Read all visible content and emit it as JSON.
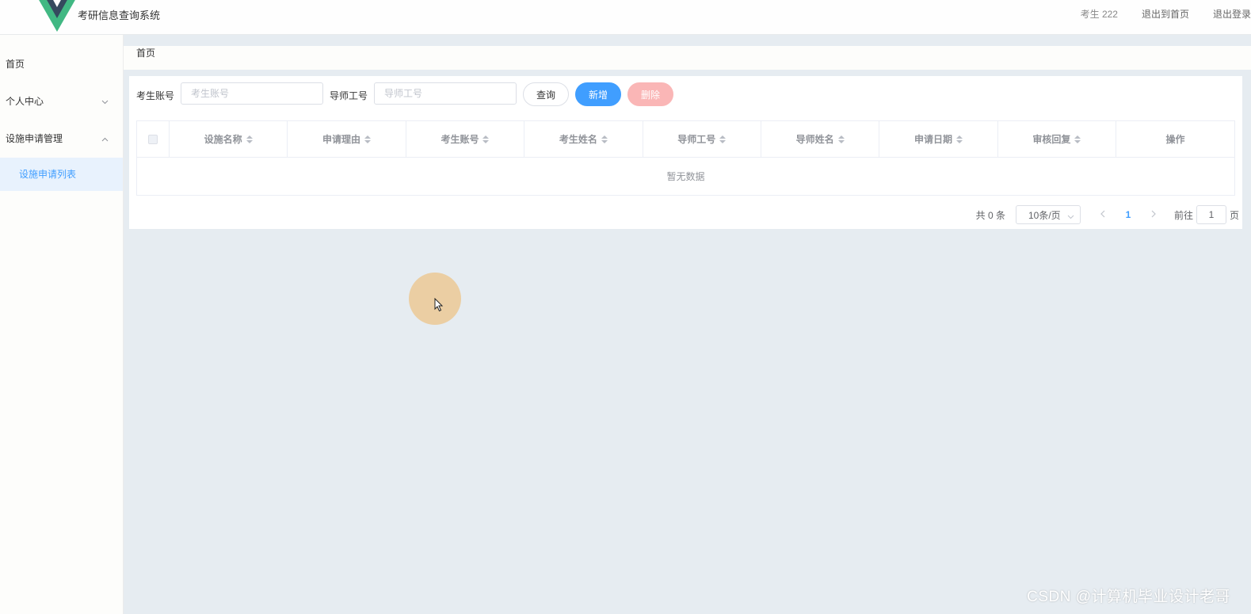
{
  "header": {
    "app_title": "考研信息查询系统",
    "user": "考生 222",
    "back_home": "退出到首页",
    "logout": "退出登录"
  },
  "sidebar": {
    "items": [
      {
        "label": "首页"
      },
      {
        "label": "个人中心"
      },
      {
        "label": "设施申请管理"
      }
    ],
    "sub_item": "设施申请列表"
  },
  "breadcrumb": "首页",
  "search": {
    "account_label": "考生账号",
    "account_placeholder": "考生账号",
    "mentor_label": "导师工号",
    "mentor_placeholder": "导师工号",
    "query": "查询",
    "add": "新增",
    "delete": "删除"
  },
  "table": {
    "columns": [
      "设施名称",
      "申请理由",
      "考生账号",
      "考生姓名",
      "导师工号",
      "导师姓名",
      "申请日期",
      "审核回复"
    ],
    "op_column": "操作",
    "empty": "暂无数据"
  },
  "pagination": {
    "total": "共 0 条",
    "page_size": "10条/页",
    "current_page": "1",
    "goto_label": "前往",
    "goto_value": "1",
    "unit": "页"
  },
  "watermark": "CSDN @计算机毕业设计老哥",
  "colors": {
    "accent": "#409eff",
    "danger_disabled": "#fab6b6",
    "main_bg": "#e6ecf1",
    "logo_green": "#41b883",
    "logo_dark": "#35495e"
  }
}
